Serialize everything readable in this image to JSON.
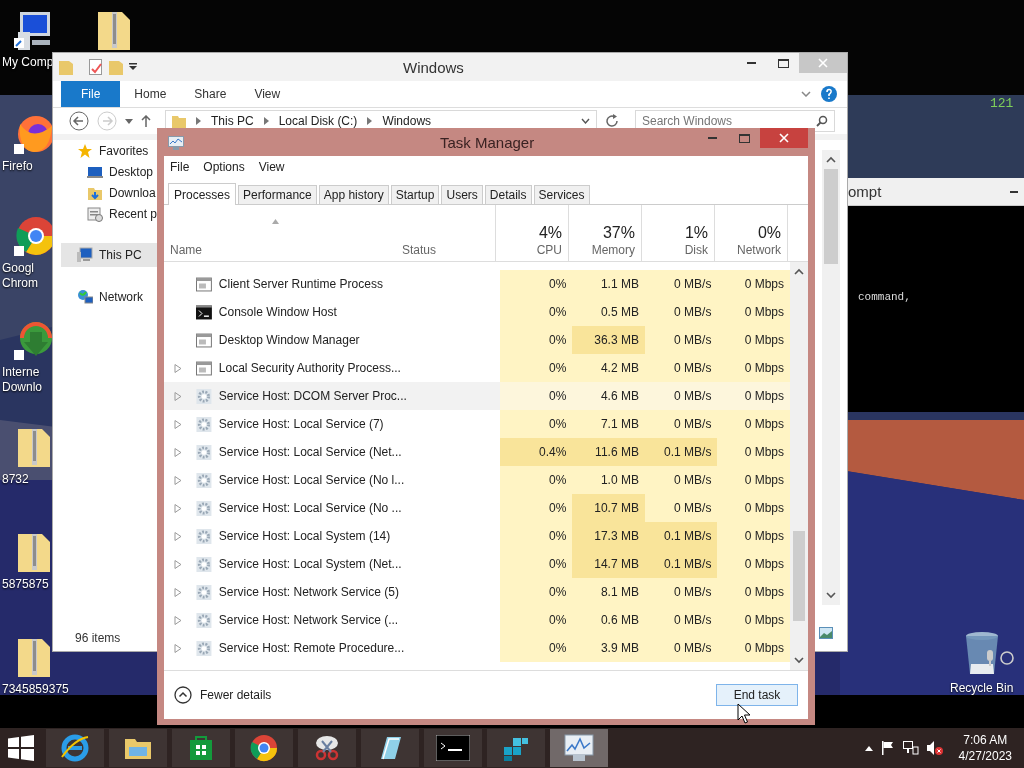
{
  "desktop_icons": [
    {
      "kind": "computer",
      "lines": [
        "My Comp"
      ]
    },
    {
      "kind": "zip"
    },
    {
      "kind": "firefox",
      "lines": [
        "Firefo"
      ]
    },
    {
      "kind": "chrome",
      "lines": [
        "Googl",
        "Chrom"
      ]
    },
    {
      "kind": "downloader",
      "lines": [
        "Interne",
        "Downlo"
      ]
    },
    {
      "kind": "zip",
      "lines": [
        "8732"
      ]
    },
    {
      "kind": "zip",
      "lines": [
        "5875875"
      ]
    },
    {
      "kind": "zip",
      "lines": [
        "7345859375"
      ]
    },
    {
      "kind": "recycle",
      "lines": [
        "Recycle Bin"
      ]
    }
  ],
  "wallpaper_text": "121",
  "command_prompt": {
    "title": "ompt",
    "output": "command,"
  },
  "explorer": {
    "title": "Windows",
    "ribbon_tabs": [
      {
        "label": "File",
        "selected": true
      },
      {
        "label": "Home",
        "selected": false
      },
      {
        "label": "Share",
        "selected": false
      },
      {
        "label": "View",
        "selected": false
      }
    ],
    "breadcrumb": [
      "This PC",
      "Local Disk (C:)",
      "Windows"
    ],
    "search": {
      "placeholder": "Search Windows"
    },
    "nav": [
      {
        "label": "Favorites",
        "kind": "favorites",
        "selected": false,
        "children": [
          {
            "label": "Desktop",
            "kind": "desktop",
            "selected": false
          },
          {
            "label": "Downloa",
            "kind": "downloads",
            "selected": false
          },
          {
            "label": "Recent p",
            "kind": "recent",
            "selected": false
          }
        ]
      },
      {
        "label": "This PC",
        "kind": "computer",
        "selected": true
      },
      {
        "label": "Network",
        "kind": "network",
        "selected": false
      }
    ],
    "status": "96 items"
  },
  "task_manager": {
    "title": "Task Manager",
    "menu": [
      "File",
      "Options",
      "View"
    ],
    "tabs": [
      {
        "label": "Processes",
        "selected": true
      },
      {
        "label": "Performance",
        "selected": false
      },
      {
        "label": "App history",
        "selected": false
      },
      {
        "label": "Startup",
        "selected": false
      },
      {
        "label": "Users",
        "selected": false
      },
      {
        "label": "Details",
        "selected": false
      },
      {
        "label": "Services",
        "selected": false
      }
    ],
    "name_column": "Name",
    "status_column": "Status",
    "metric_columns": [
      {
        "label": "CPU",
        "total": "4%"
      },
      {
        "label": "Memory",
        "total": "37%"
      },
      {
        "label": "Disk",
        "total": "1%"
      },
      {
        "label": "Network",
        "total": "0%"
      }
    ],
    "rows": [
      {
        "name": "Client Server Runtime Process",
        "kind": "app",
        "expandable": false,
        "highlighted": false,
        "cells": [
          {
            "text": "0%",
            "hot": false
          },
          {
            "text": "1.1 MB",
            "hot": false
          },
          {
            "text": "0 MB/s",
            "hot": false
          },
          {
            "text": "0 Mbps",
            "hot": false
          }
        ]
      },
      {
        "name": "Console Window Host",
        "kind": "console",
        "expandable": false,
        "highlighted": false,
        "cells": [
          {
            "text": "0%",
            "hot": false
          },
          {
            "text": "0.5 MB",
            "hot": false
          },
          {
            "text": "0 MB/s",
            "hot": false
          },
          {
            "text": "0 Mbps",
            "hot": false
          }
        ]
      },
      {
        "name": "Desktop Window Manager",
        "kind": "app",
        "expandable": false,
        "highlighted": false,
        "cells": [
          {
            "text": "0%",
            "hot": false
          },
          {
            "text": "36.3 MB",
            "hot": true
          },
          {
            "text": "0 MB/s",
            "hot": false
          },
          {
            "text": "0 Mbps",
            "hot": false
          }
        ]
      },
      {
        "name": "Local Security Authority Process...",
        "kind": "app",
        "expandable": true,
        "highlighted": false,
        "cells": [
          {
            "text": "0%",
            "hot": false
          },
          {
            "text": "4.2 MB",
            "hot": false
          },
          {
            "text": "0 MB/s",
            "hot": false
          },
          {
            "text": "0 Mbps",
            "hot": false
          }
        ]
      },
      {
        "name": "Service Host: DCOM Server Proc...",
        "kind": "service",
        "expandable": true,
        "highlighted": true,
        "cells": [
          {
            "text": "0%",
            "hot": false
          },
          {
            "text": "4.6 MB",
            "hot": false
          },
          {
            "text": "0 MB/s",
            "hot": false
          },
          {
            "text": "0 Mbps",
            "hot": false
          }
        ]
      },
      {
        "name": "Service Host: Local Service (7)",
        "kind": "service",
        "expandable": true,
        "highlighted": false,
        "cells": [
          {
            "text": "0%",
            "hot": false
          },
          {
            "text": "7.1 MB",
            "hot": false
          },
          {
            "text": "0 MB/s",
            "hot": false
          },
          {
            "text": "0 Mbps",
            "hot": false
          }
        ]
      },
      {
        "name": "Service Host: Local Service (Net...",
        "kind": "service",
        "expandable": true,
        "highlighted": false,
        "cells": [
          {
            "text": "0.4%",
            "hot": true
          },
          {
            "text": "11.6 MB",
            "hot": true
          },
          {
            "text": "0.1 MB/s",
            "hot": true
          },
          {
            "text": "0 Mbps",
            "hot": false
          }
        ]
      },
      {
        "name": "Service Host: Local Service (No l...",
        "kind": "service",
        "expandable": true,
        "highlighted": false,
        "cells": [
          {
            "text": "0%",
            "hot": false
          },
          {
            "text": "1.0 MB",
            "hot": false
          },
          {
            "text": "0 MB/s",
            "hot": false
          },
          {
            "text": "0 Mbps",
            "hot": false
          }
        ]
      },
      {
        "name": "Service Host: Local Service (No ...",
        "kind": "service",
        "expandable": true,
        "highlighted": false,
        "cells": [
          {
            "text": "0%",
            "hot": false
          },
          {
            "text": "10.7 MB",
            "hot": true
          },
          {
            "text": "0 MB/s",
            "hot": false
          },
          {
            "text": "0 Mbps",
            "hot": false
          }
        ]
      },
      {
        "name": "Service Host: Local System (14)",
        "kind": "service",
        "expandable": true,
        "highlighted": false,
        "cells": [
          {
            "text": "0%",
            "hot": false
          },
          {
            "text": "17.3 MB",
            "hot": true
          },
          {
            "text": "0.1 MB/s",
            "hot": true
          },
          {
            "text": "0 Mbps",
            "hot": false
          }
        ]
      },
      {
        "name": "Service Host: Local System (Net...",
        "kind": "service",
        "expandable": true,
        "highlighted": false,
        "cells": [
          {
            "text": "0%",
            "hot": false
          },
          {
            "text": "14.7 MB",
            "hot": true
          },
          {
            "text": "0.1 MB/s",
            "hot": true
          },
          {
            "text": "0 Mbps",
            "hot": false
          }
        ]
      },
      {
        "name": "Service Host: Network Service (5)",
        "kind": "service",
        "expandable": true,
        "highlighted": false,
        "cells": [
          {
            "text": "0%",
            "hot": false
          },
          {
            "text": "8.1 MB",
            "hot": false
          },
          {
            "text": "0 MB/s",
            "hot": false
          },
          {
            "text": "0 Mbps",
            "hot": false
          }
        ]
      },
      {
        "name": "Service Host: Network Service (...",
        "kind": "service",
        "expandable": true,
        "highlighted": false,
        "cells": [
          {
            "text": "0%",
            "hot": false
          },
          {
            "text": "0.6 MB",
            "hot": false
          },
          {
            "text": "0 MB/s",
            "hot": false
          },
          {
            "text": "0 Mbps",
            "hot": false
          }
        ]
      },
      {
        "name": "Service Host: Remote Procedure...",
        "kind": "service",
        "expandable": true,
        "highlighted": false,
        "cells": [
          {
            "text": "0%",
            "hot": false
          },
          {
            "text": "3.9 MB",
            "hot": false
          },
          {
            "text": "0 MB/s",
            "hot": false
          },
          {
            "text": "0 Mbps",
            "hot": false
          }
        ]
      }
    ],
    "fewer_details": "Fewer details",
    "end_task": "End task"
  },
  "taskbar": {
    "items": [
      {
        "kind": "ie",
        "active": false
      },
      {
        "kind": "explorer",
        "active": false
      },
      {
        "kind": "store",
        "active": false
      },
      {
        "kind": "chrome",
        "active": false
      },
      {
        "kind": "snip",
        "active": false
      },
      {
        "kind": "notepad",
        "active": false
      },
      {
        "kind": "cmd",
        "active": false
      },
      {
        "kind": "regedit",
        "active": false
      },
      {
        "kind": "taskmgr",
        "active": true
      }
    ],
    "time": "7:06 AM",
    "date": "4/27/2023"
  }
}
